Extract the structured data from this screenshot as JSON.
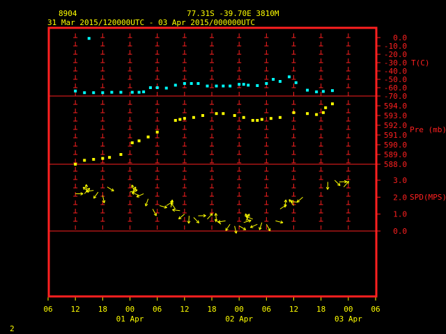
{
  "header": {
    "station_id": "8904",
    "location": "77.31S  -39.70E  3810M",
    "time_range": "31 Mar 2015/120000UTC - 03 Apr 2015/000000UTC"
  },
  "footer": {
    "page_number": "2"
  },
  "colors": {
    "frame": "#ff2020",
    "axis_text": "#ff2020",
    "time_text": "#ffff00",
    "temperature": "#00ffff",
    "pressure": "#ffff00",
    "wind": "#ffff00"
  },
  "chart_data": {
    "type": "scatter",
    "x_axis": {
      "tick_labels": [
        "06",
        "12",
        "18",
        "00",
        "06",
        "12",
        "18",
        "00",
        "06",
        "12",
        "18",
        "00",
        "06"
      ],
      "tick_hours": [
        -6,
        0,
        6,
        12,
        18,
        24,
        30,
        36,
        42,
        48,
        54,
        60,
        66
      ],
      "range_hours": [
        -6,
        66
      ],
      "day_labels": [
        {
          "label": "01 Apr",
          "hour": 12
        },
        {
          "label": "02 Apr",
          "hour": 36
        },
        {
          "label": "03 Apr",
          "hour": 60
        }
      ],
      "grid": true
    },
    "panels": [
      {
        "name": "temperature",
        "ylabel": "T(C)",
        "tick_labels": [
          "0.0",
          "-10.0",
          "-20.0",
          "-30.0",
          "-40.0",
          "-50.0",
          "-60.0",
          "-70.0"
        ],
        "tick_values": [
          0,
          -10,
          -20,
          -30,
          -40,
          -50,
          -60,
          -70
        ],
        "ylim": [
          -70,
          0
        ],
        "points": [
          [
            0,
            -64
          ],
          [
            2,
            -66
          ],
          [
            4,
            -66
          ],
          [
            6,
            -66
          ],
          [
            8,
            -65.5
          ],
          [
            10,
            -65.5
          ],
          [
            12.5,
            -65.5
          ],
          [
            14,
            -65.5
          ],
          [
            15,
            -65
          ],
          [
            16.5,
            -60
          ],
          [
            18,
            -60
          ],
          [
            20,
            -60.5
          ],
          [
            22,
            -57
          ],
          [
            24,
            -55
          ],
          [
            25.5,
            -55
          ],
          [
            27,
            -55
          ],
          [
            29,
            -58
          ],
          [
            31,
            -58
          ],
          [
            32.5,
            -58
          ],
          [
            34,
            -58
          ],
          [
            36,
            -56
          ],
          [
            37,
            -56
          ],
          [
            38,
            -57
          ],
          [
            40,
            -57.5
          ],
          [
            42,
            -55
          ],
          [
            43.5,
            -50
          ],
          [
            45,
            -52.5
          ],
          [
            47,
            -47
          ],
          [
            48.5,
            -54
          ],
          [
            51,
            -63
          ],
          [
            53,
            -65
          ],
          [
            54.5,
            -64.5
          ],
          [
            56.5,
            -63.5
          ],
          [
            3,
            -1
          ]
        ]
      },
      {
        "name": "pressure",
        "ylabel": "Pre (mb)",
        "tick_labels": [
          "594.0",
          "593.0",
          "592.0",
          "591.0",
          "590.0",
          "589.0",
          "588.0"
        ],
        "tick_values": [
          594,
          593,
          592,
          591,
          590,
          589,
          588
        ],
        "ylim": [
          588,
          594
        ],
        "points": [
          [
            0,
            588
          ],
          [
            2,
            588.4
          ],
          [
            4,
            588.5
          ],
          [
            6,
            588.6
          ],
          [
            7.5,
            588.7
          ],
          [
            10,
            589
          ],
          [
            12.5,
            590.2
          ],
          [
            14,
            590.4
          ],
          [
            16,
            590.8
          ],
          [
            18,
            591.3
          ],
          [
            22,
            592.5
          ],
          [
            23,
            592.6
          ],
          [
            24,
            592.7
          ],
          [
            26,
            592.8
          ],
          [
            28,
            593
          ],
          [
            31,
            593.2
          ],
          [
            32.5,
            593.2
          ],
          [
            35,
            593
          ],
          [
            37,
            592.8
          ],
          [
            39,
            592.5
          ],
          [
            40,
            592.5
          ],
          [
            41,
            592.6
          ],
          [
            43,
            592.7
          ],
          [
            45,
            592.8
          ],
          [
            48,
            593.3
          ],
          [
            51,
            593.2
          ],
          [
            53,
            593.1
          ],
          [
            54.5,
            593.3
          ],
          [
            55,
            593.8
          ],
          [
            56.5,
            594.2
          ]
        ]
      },
      {
        "name": "wind",
        "ylabel": "SPD(MPS)",
        "tick_labels": [
          "3.0",
          "2.0",
          "1.0",
          "0.0"
        ],
        "tick_values": [
          3,
          2,
          1,
          0
        ],
        "ylim": [
          0,
          3
        ],
        "points": [
          [
            0,
            2.2
          ],
          [
            2,
            2.2
          ],
          [
            2.5,
            2.3
          ],
          [
            3,
            2.3
          ],
          [
            4,
            2.4
          ],
          [
            5,
            2.3
          ],
          [
            6,
            2.1
          ],
          [
            7,
            2.6
          ],
          [
            12,
            2.3
          ],
          [
            12.5,
            2.2
          ],
          [
            13,
            2.3
          ],
          [
            14,
            2.1
          ],
          [
            15,
            2.2
          ],
          [
            16,
            1.9
          ],
          [
            17,
            1.3
          ],
          [
            18.5,
            1.5
          ],
          [
            20,
            1.5
          ],
          [
            21,
            1.4
          ],
          [
            22,
            1.3
          ],
          [
            23,
            1.2
          ],
          [
            24,
            1.0
          ],
          [
            25,
            0.9
          ],
          [
            26,
            0.8
          ],
          [
            27,
            0.9
          ],
          [
            29,
            0.7
          ],
          [
            31,
            0.6
          ],
          [
            32,
            0.4
          ],
          [
            33,
            0.6
          ],
          [
            34,
            0.4
          ],
          [
            35,
            0.3
          ],
          [
            36,
            0.3
          ],
          [
            37,
            0.5
          ],
          [
            37.5,
            0.6
          ],
          [
            38,
            0.6
          ],
          [
            39,
            0.7
          ],
          [
            40,
            0.4
          ],
          [
            41,
            0.5
          ],
          [
            42,
            0.4
          ],
          [
            44,
            0.6
          ],
          [
            45,
            1.3
          ],
          [
            46,
            1.4
          ],
          [
            48,
            1.5
          ],
          [
            49,
            1.7
          ],
          [
            50,
            2.0
          ],
          [
            55.5,
            2.9
          ],
          [
            57,
            3.0
          ],
          [
            58,
            2.9
          ],
          [
            59,
            2.6
          ]
        ]
      }
    ]
  }
}
